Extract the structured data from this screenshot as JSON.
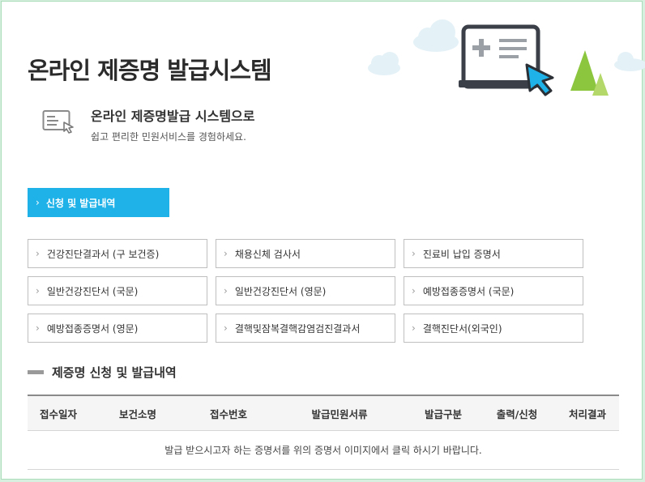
{
  "page": {
    "title": "온라인 제증명 발급시스템"
  },
  "intro": {
    "icon": "certificate-cursor-icon",
    "title": "온라인 제증명발급 시스템으로",
    "subtitle": "쉽고 편리한 민원서비스를 경험하세요."
  },
  "hero": {
    "icons": [
      "cloud-icon",
      "monitor-document-icon",
      "cursor-arrow-icon",
      "tree-icon"
    ],
    "colors": {
      "monitor_border": "#3a3f48",
      "accent_cursor": "#1fb2e8",
      "tree": "#8cc63f",
      "cloud": "#e6f2f7"
    }
  },
  "issue_button": {
    "label": "신청 및 발급내역",
    "color": "#1fb2e8"
  },
  "certificates": [
    "건강진단결과서 (구 보건증)",
    "채용신체 검사서",
    "진료비 납입 증명서",
    "일반건강진단서 (국문)",
    "일반건강진단서 (영문)",
    "예방접종증명서 (국문)",
    "예방접종증명서 (영문)",
    "결핵및잠복결핵감염검진결과서",
    "결핵진단서(외국인)"
  ],
  "history": {
    "section_title": "제증명 신청 및 발급내역",
    "columns": [
      "접수일자",
      "보건소명",
      "접수번호",
      "발급민원서류",
      "발급구분",
      "출력/신청",
      "처리결과"
    ],
    "empty_message": "발급 받으시고자 하는 증명서를 위의 증명서 이미지에서 클릭 하시기 바랍니다."
  }
}
